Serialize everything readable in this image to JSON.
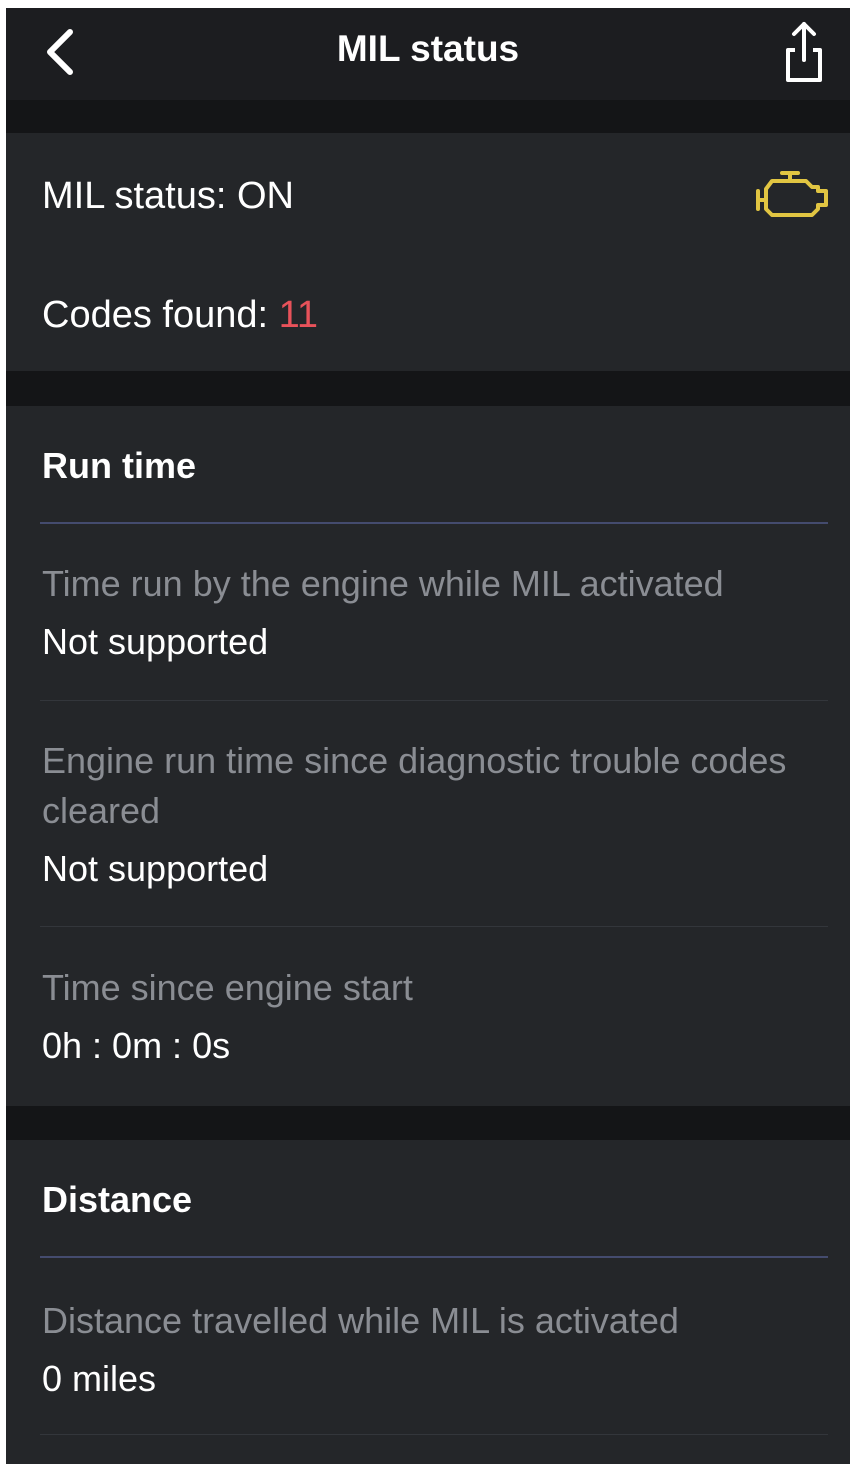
{
  "header": {
    "title": "MIL status",
    "back_icon": "chevron-left-icon",
    "share_icon": "share-icon"
  },
  "status": {
    "mil_label": "MIL status: ",
    "mil_value": "ON",
    "codes_label": "Codes found: ",
    "codes_count": "11",
    "engine_icon": "check-engine-icon",
    "engine_icon_color": "#e1c542",
    "codes_count_color": "#e8525a"
  },
  "run_time": {
    "title": "Run time",
    "items": [
      {
        "label": "Time run by the engine while MIL activated",
        "value": "Not supported"
      },
      {
        "label": "Engine run time since diagnostic trouble codes cleared",
        "value": "Not supported"
      },
      {
        "label": "Time since engine start",
        "value": "0h : 0m : 0s"
      }
    ]
  },
  "distance": {
    "title": "Distance",
    "items": [
      {
        "label": "Distance travelled while MIL is activated",
        "value": "0 miles"
      }
    ]
  }
}
